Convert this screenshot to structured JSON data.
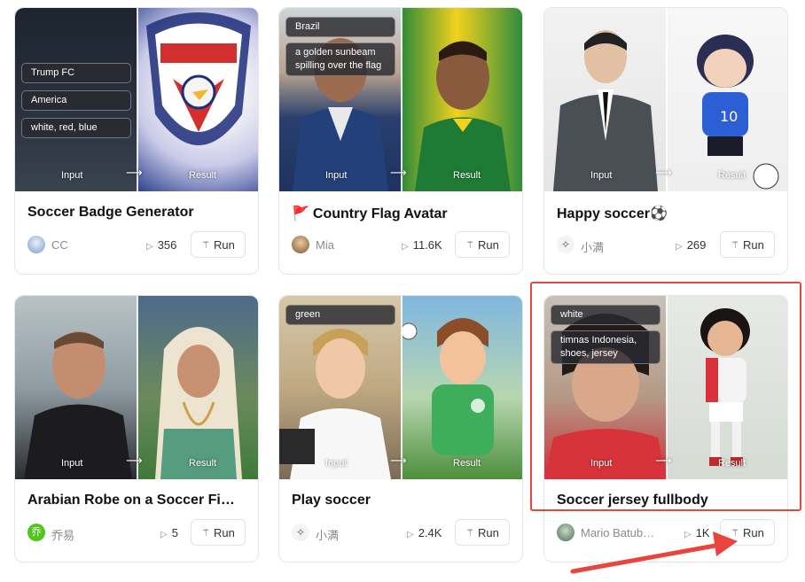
{
  "labels": {
    "input": "Input",
    "result": "Result",
    "run": "Run",
    "arrow": "⟶"
  },
  "cards": [
    {
      "title": "Soccer Badge Generator",
      "author": "CC",
      "plays": "356",
      "tags": [
        "Trump FC",
        "America",
        "white, red, blue"
      ]
    },
    {
      "title": "Country Flag Avatar",
      "title_emoji": "🚩",
      "author": "Mia",
      "plays": "11.6K",
      "tags": [
        "Brazil",
        "a golden sunbeam spilling over the flag"
      ]
    },
    {
      "title": "Happy soccer⚽",
      "author": "小满",
      "plays": "269",
      "tags": []
    },
    {
      "title": "Arabian Robe on a Soccer Fi…",
      "author": "乔易",
      "avatar_text": "乔",
      "plays": "5",
      "tags": []
    },
    {
      "title": "Play soccer",
      "author": "小满",
      "plays": "2.4K",
      "tags": [
        "green"
      ]
    },
    {
      "title": "Soccer jersey fullbody",
      "author": "Mario Batub…",
      "plays": "1K",
      "tags": [
        "white",
        "timnas Indonesia, shoes, jersey"
      ]
    }
  ],
  "colors": {
    "highlight": "#e8453c",
    "accent_avatar_green": "#52c41a"
  }
}
